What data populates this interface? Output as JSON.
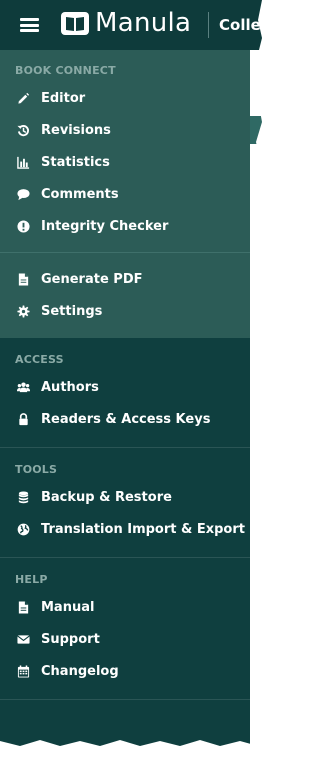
{
  "header": {
    "brand": "Manula",
    "section_title": "Collec"
  },
  "sidebar": {
    "book_connect": {
      "title": "BOOK CONNECT",
      "items": [
        {
          "label": "Editor",
          "icon": "pencil-icon"
        },
        {
          "label": "Revisions",
          "icon": "history-icon"
        },
        {
          "label": "Statistics",
          "icon": "bar-chart-icon"
        },
        {
          "label": "Comments",
          "icon": "comment-icon"
        },
        {
          "label": "Integrity Checker",
          "icon": "exclamation-circle-icon"
        }
      ],
      "items2": [
        {
          "label": "Generate PDF",
          "icon": "file-icon"
        },
        {
          "label": "Settings",
          "icon": "gear-icon"
        }
      ]
    },
    "access": {
      "title": "ACCESS",
      "items": [
        {
          "label": "Authors",
          "icon": "users-icon"
        },
        {
          "label": "Readers & Access Keys",
          "icon": "lock-icon"
        }
      ]
    },
    "tools": {
      "title": "TOOLS",
      "items": [
        {
          "label": "Backup & Restore",
          "icon": "database-icon"
        },
        {
          "label": "Translation Import & Export",
          "icon": "globe-icon"
        }
      ]
    },
    "help": {
      "title": "HELP",
      "items": [
        {
          "label": "Manual",
          "icon": "file-icon"
        },
        {
          "label": "Support",
          "icon": "envelope-icon"
        },
        {
          "label": "Changelog",
          "icon": "calendar-icon"
        }
      ]
    }
  },
  "colors": {
    "header_bg": "#0e3b3b",
    "light_section_bg": "#2c5c57",
    "dark_section_bg": "#0f3f3f",
    "section_title": "#8aaaa6",
    "text": "#ffffff"
  }
}
